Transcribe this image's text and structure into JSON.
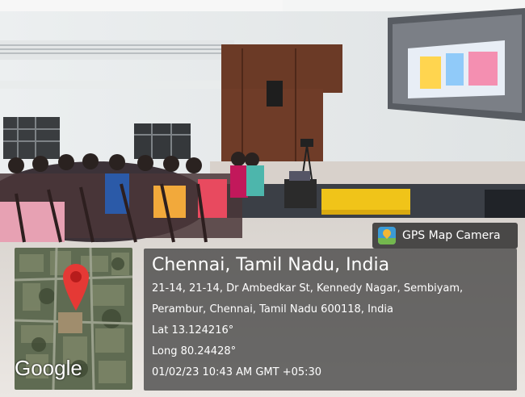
{
  "badge": {
    "label": "GPS Map Camera",
    "icon": "gps-map-camera-app-icon"
  },
  "location": {
    "title": "Chennai, Tamil Nadu, India",
    "address_line1": "21-14, 21-14, Dr Ambedkar St, Kennedy Nagar, Sembiyam,",
    "address_line2": "Perambur, Chennai, Tamil Nadu 600118, India",
    "latitude": "Lat 13.124216°",
    "longitude": "Long 80.24428°",
    "timestamp": "01/02/23 10:43 AM GMT +05:30"
  },
  "map": {
    "brand": "Google",
    "marker_color": "#e53935"
  },
  "colors": {
    "panel": "#3a3a3a",
    "text": "#ffffff",
    "marker": "#e53935"
  }
}
